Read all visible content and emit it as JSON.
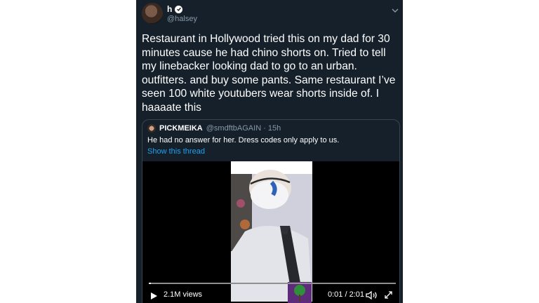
{
  "tweet": {
    "name": "h",
    "handle": "@halsey",
    "text": "Restaurant in Hollywood tried this         on my dad for 30 minutes cause he had chino shorts on. Tried to tell my linebacker looking        dad to go to an urban. outfitters. and buy some pants. Same restaurant I’ve seen 100 white youtubers wear shorts inside of. I haaaate this"
  },
  "quote": {
    "name": "PICKMEIKA",
    "handle": "@smdftbAGAIN · 15h",
    "text": "He had no answer for her. Dress codes only apply to us.",
    "link": "Show this thread"
  },
  "video": {
    "views": "2.1M views",
    "time": "0:01 / 2:01",
    "progress": 0.008
  },
  "colors": {
    "background": "#15202b",
    "link": "#1da1f2",
    "muted": "#8899a6"
  },
  "icons": [
    "verified-badge-icon",
    "chevron-down-icon",
    "play-icon",
    "volume-icon",
    "fullscreen-icon"
  ]
}
